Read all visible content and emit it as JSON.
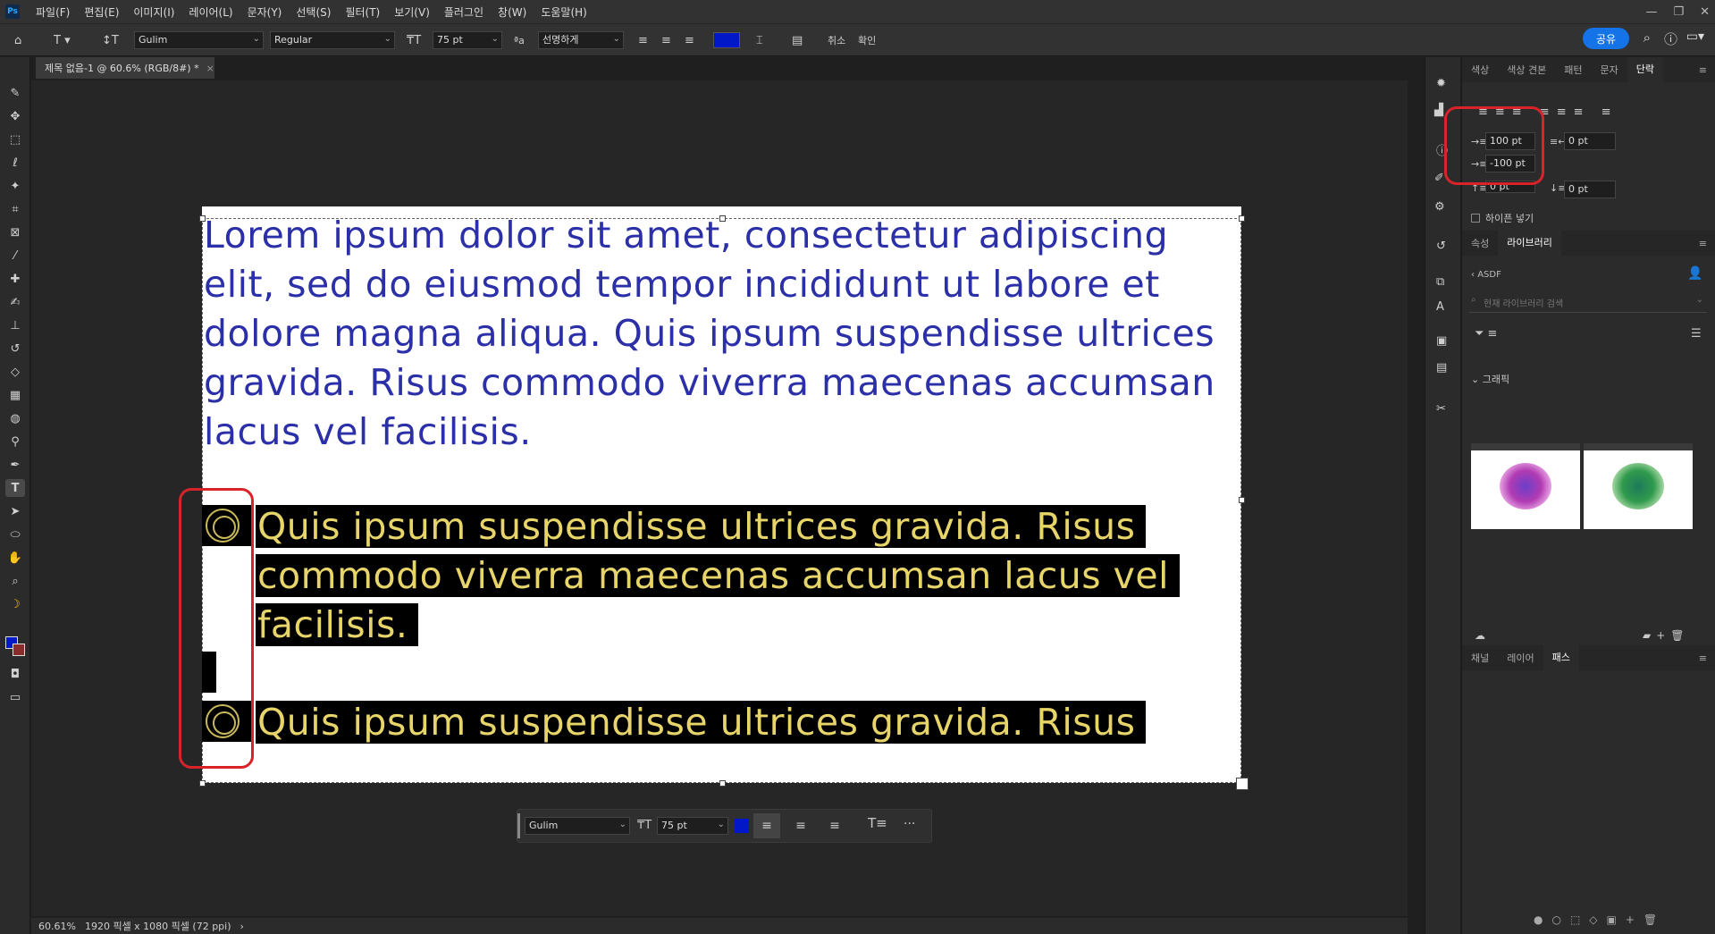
{
  "menu": [
    "파일(F)",
    "편집(E)",
    "이미지(I)",
    "레이어(L)",
    "문자(Y)",
    "선택(S)",
    "필터(T)",
    "보기(V)",
    "플러그인",
    "창(W)",
    "도움말(H)"
  ],
  "options": {
    "font_family": "Gulim",
    "font_style": "Regular",
    "font_size": "75 pt",
    "antialias": "선명하게",
    "text_color": "#0018c8",
    "cancel": "취소",
    "commit": "확인",
    "share_label": "공유"
  },
  "document": {
    "tab_title": "제목 없음-1 @ 60.6% (RGB/8#) *",
    "paragraph1_lines": [
      "Lorem ipsum dolor sit amet, consectetur adipiscing",
      "elit, sed do eiusmod tempor incididunt ut labore et",
      "dolore magna aliqua. Quis ipsum suspendisse ultrices",
      "gravida. Risus commodo viverra maecenas accumsan",
      "lacus vel facilisis."
    ],
    "list_item1_lines": [
      "Quis ipsum suspendisse ultrices gravida. Risus",
      "commodo viverra maecenas accumsan lacus vel",
      "facilisis."
    ],
    "list_item2_line": "Quis ipsum suspendisse ultrices gravida. Risus"
  },
  "context_bar": {
    "font": "Gulim",
    "size": "75 pt",
    "more": "···"
  },
  "status": {
    "zoom": "60.61%",
    "info": "1920 픽셀 x 1080 픽셀 (72 ppi)"
  },
  "panels": {
    "top_tabs": [
      "색상",
      "색상 견본",
      "패턴",
      "문자",
      "단락"
    ],
    "left_indent": "100 pt",
    "right_indent": "0 pt",
    "first_line_indent": "-100 pt",
    "space_before": "0 pt",
    "space_after": "0 pt",
    "hyphenate_label": "하이픈 넣기",
    "mid_tabs": [
      "속성",
      "라이브러리"
    ],
    "library_name": "ASDF",
    "library_search_placeholder": "현재 라이브러리 검색",
    "graphics_label": "그래픽",
    "bottom_tabs": [
      "채널",
      "레이어",
      "패스"
    ]
  }
}
